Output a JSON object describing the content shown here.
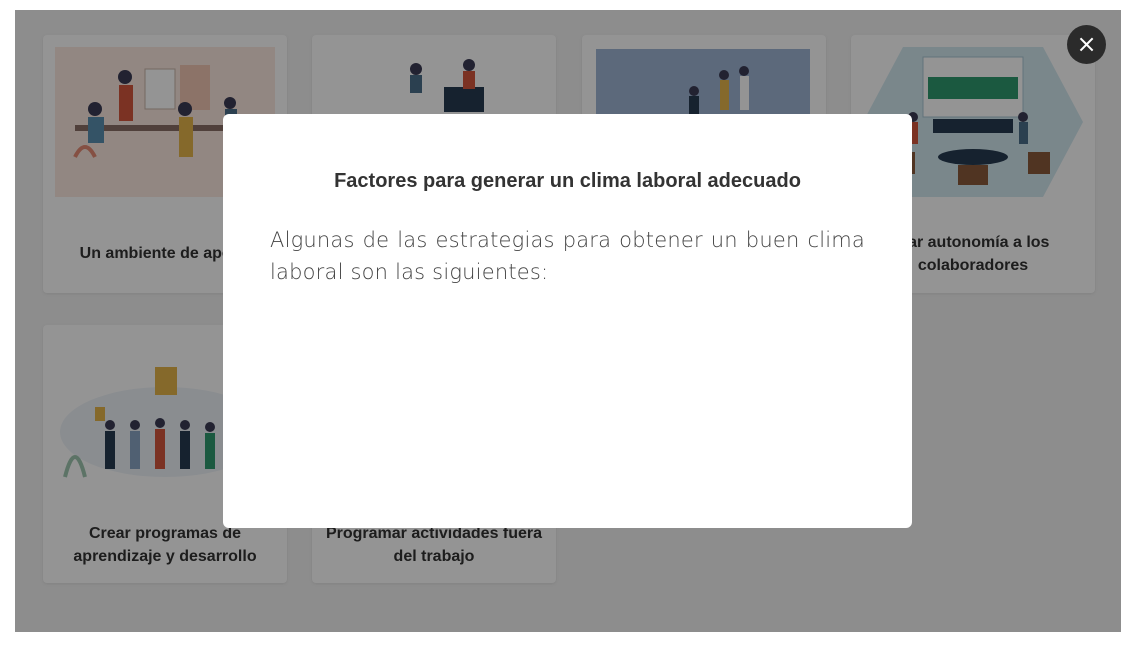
{
  "cards": [
    {
      "caption": "Un ambiente de apoyo"
    },
    {
      "caption": ""
    },
    {
      "caption": ""
    },
    {
      "caption": "Dar autonomía a los colaboradores"
    },
    {
      "caption": "Crear programas de aprendizaje y desarrollo"
    },
    {
      "caption": "Programar actividades fuera del trabajo"
    }
  ],
  "modal": {
    "title": "Factores para generar un clima laboral adecuado",
    "body": "Algunas de las estrategias para obtener un buen clima laboral son las siguientes:",
    "close_icon": "×"
  },
  "colors": {
    "overlay": "#000000",
    "close_button": "#2b2b2b",
    "modal_background": "#ffffff"
  }
}
